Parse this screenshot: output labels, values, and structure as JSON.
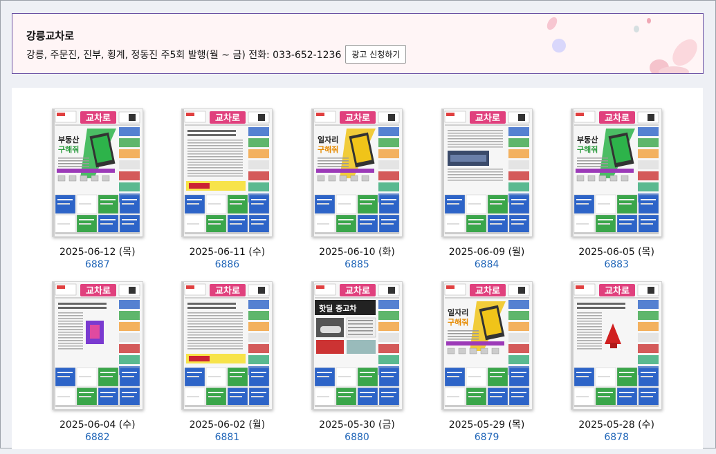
{
  "header": {
    "title": "강릉교차로",
    "info": "강릉, 주문진, 진부, 횡계, 정동진 주5회 발행(월 ~ 금) 전화: 033-652-1236",
    "ad_button": "광고 신청하기"
  },
  "issues": [
    {
      "date": "2025-06-12 (목)",
      "number": "6887",
      "masthead": "교차로",
      "headline": "부동산 구해줘",
      "theme": "realestate"
    },
    {
      "date": "2025-06-11 (수)",
      "number": "6886",
      "masthead": "교차로",
      "headline": "",
      "theme": "text"
    },
    {
      "date": "2025-06-10 (화)",
      "number": "6885",
      "masthead": "교차로",
      "headline": "일자리 구해줘",
      "theme": "jobs"
    },
    {
      "date": "2025-06-09 (월)",
      "number": "6884",
      "masthead": "교차로",
      "headline": "",
      "theme": "photo"
    },
    {
      "date": "2025-06-05 (목)",
      "number": "6883",
      "masthead": "교차로",
      "headline": "부동산 구해줘",
      "theme": "realestate"
    },
    {
      "date": "2025-06-04 (수)",
      "number": "6882",
      "masthead": "교차로",
      "headline": "",
      "theme": "text-purple"
    },
    {
      "date": "2025-06-02 (월)",
      "number": "6881",
      "masthead": "교차로",
      "headline": "",
      "theme": "text"
    },
    {
      "date": "2025-05-30 (금)",
      "number": "6880",
      "masthead": "교차로",
      "headline": "핫딜 중고차",
      "theme": "cars"
    },
    {
      "date": "2025-05-29 (목)",
      "number": "6879",
      "masthead": "교차로",
      "headline": "일자리 구해줘",
      "theme": "jobs"
    },
    {
      "date": "2025-05-28 (수)",
      "number": "6878",
      "masthead": "교차로",
      "headline": "",
      "theme": "text-red"
    }
  ],
  "colors": {
    "masthead": "#e0407d",
    "header_border": "#6a4fa3",
    "link": "#2166b8",
    "realestate_accent": "#2db34a",
    "jobs_accent": "#f0c419",
    "ad_blue": "#2d64c8",
    "ad_green": "#3aa64a",
    "ad_orange": "#f2a03a"
  }
}
